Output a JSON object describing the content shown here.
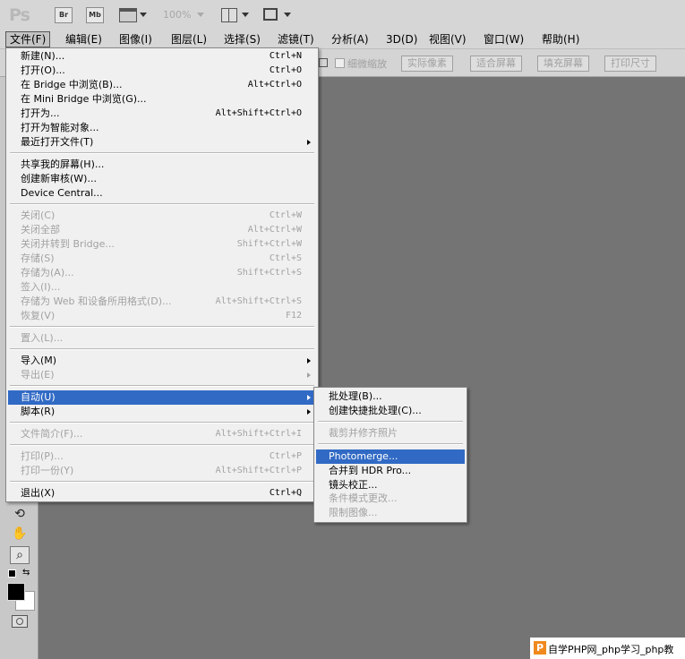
{
  "app": {
    "logo": "Ps",
    "zoom": "100%"
  },
  "toolbar": {
    "bridge": "Br",
    "minibridge": "Mb"
  },
  "menubar": [
    {
      "label": "文件(F)"
    },
    {
      "label": "编辑(E)"
    },
    {
      "label": "图像(I)"
    },
    {
      "label": "图层(L)"
    },
    {
      "label": "选择(S)"
    },
    {
      "label": "滤镜(T)"
    },
    {
      "label": "分析(A)"
    },
    {
      "label": "3D(D)"
    },
    {
      "label": "视图(V)"
    },
    {
      "label": "窗口(W)"
    },
    {
      "label": "帮助(H)"
    }
  ],
  "options": {
    "scrubby_zoom": "细微缩放",
    "actual_pixels": "实际像素",
    "fit_screen": "适合屏幕",
    "fill_screen": "填充屏幕",
    "print_size": "打印尺寸"
  },
  "file_menu": [
    {
      "label": "新建(N)...",
      "shortcut": "Ctrl+N"
    },
    {
      "label": "打开(O)...",
      "shortcut": "Ctrl+O"
    },
    {
      "label": "在 Bridge 中浏览(B)...",
      "shortcut": "Alt+Ctrl+O"
    },
    {
      "label": "在 Mini Bridge 中浏览(G)...",
      "shortcut": ""
    },
    {
      "label": "打开为...",
      "shortcut": "Alt+Shift+Ctrl+O"
    },
    {
      "label": "打开为智能对象...",
      "shortcut": ""
    },
    {
      "label": "最近打开文件(T)",
      "shortcut": ""
    },
    {
      "label": "共享我的屏幕(H)...",
      "shortcut": ""
    },
    {
      "label": "创建新审核(W)...",
      "shortcut": ""
    },
    {
      "label": "Device Central...",
      "shortcut": ""
    },
    {
      "label": "关闭(C)",
      "shortcut": "Ctrl+W"
    },
    {
      "label": "关闭全部",
      "shortcut": "Alt+Ctrl+W"
    },
    {
      "label": "关闭并转到 Bridge...",
      "shortcut": "Shift+Ctrl+W"
    },
    {
      "label": "存储(S)",
      "shortcut": "Ctrl+S"
    },
    {
      "label": "存储为(A)...",
      "shortcut": "Shift+Ctrl+S"
    },
    {
      "label": "签入(I)...",
      "shortcut": ""
    },
    {
      "label": "存储为 Web 和设备所用格式(D)...",
      "shortcut": "Alt+Shift+Ctrl+S"
    },
    {
      "label": "恢复(V)",
      "shortcut": "F12"
    },
    {
      "label": "置入(L)...",
      "shortcut": ""
    },
    {
      "label": "导入(M)",
      "shortcut": ""
    },
    {
      "label": "导出(E)",
      "shortcut": ""
    },
    {
      "label": "自动(U)",
      "shortcut": ""
    },
    {
      "label": "脚本(R)",
      "shortcut": ""
    },
    {
      "label": "文件简介(F)...",
      "shortcut": "Alt+Shift+Ctrl+I"
    },
    {
      "label": "打印(P)...",
      "shortcut": "Ctrl+P"
    },
    {
      "label": "打印一份(Y)",
      "shortcut": "Alt+Shift+Ctrl+P"
    },
    {
      "label": "退出(X)",
      "shortcut": "Ctrl+Q"
    }
  ],
  "automate_menu": [
    {
      "label": "批处理(B)..."
    },
    {
      "label": "创建快捷批处理(C)..."
    },
    {
      "label": "裁剪并修齐照片"
    },
    {
      "label": "Photomerge..."
    },
    {
      "label": "合并到 HDR Pro..."
    },
    {
      "label": "镜头校正..."
    },
    {
      "label": "条件模式更改..."
    },
    {
      "label": "限制图像..."
    }
  ],
  "watermark": {
    "logo": "P",
    "text": "自学PHP网_php学习_php教"
  }
}
